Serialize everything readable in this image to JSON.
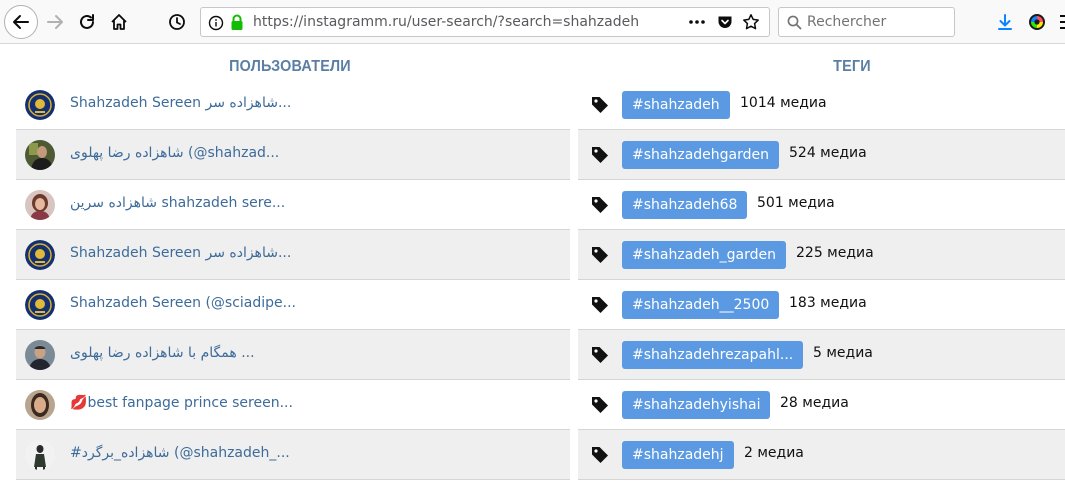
{
  "browser": {
    "url": "https://instagramm.ru/user-search/?search=shahzadeh",
    "search_placeholder": "Rechercher"
  },
  "headers": {
    "users": "ПОЛЬЗОВАТЕЛИ",
    "tags": "ТЕГИ"
  },
  "colors": {
    "header_blue": "#5b7ea4",
    "link_blue": "#3d6b9a",
    "tag_pill": "#5b9ae2",
    "row_alt": "#efefef"
  },
  "users": [
    {
      "name": "Shahzadeh Sereen شاهزاده سر...",
      "avatar": "emblem-avatar"
    },
    {
      "name": "شاهزاده رضا پهلوی (@shahzad...",
      "avatar": "photo-avatar"
    },
    {
      "name": "شاهزاده سرین shahzadeh sere...",
      "avatar": "photo-avatar"
    },
    {
      "name": "Shahzadeh Sereen شاهزاده سر...",
      "avatar": "emblem-avatar"
    },
    {
      "name": "Shahzadeh Sereen (@sciadipe...",
      "avatar": "emblem-avatar"
    },
    {
      "name": "همگام با شاهزاده رضا پهلوی ...",
      "avatar": "photo-avatar"
    },
    {
      "name": "best fanpage prince sereen...",
      "avatar": "photo-avatar",
      "prefix_icon": "💋"
    },
    {
      "name": "#شاهزاده_برگرد (@shahzadeh_...",
      "avatar": "photo-avatar"
    }
  ],
  "tags": [
    {
      "label": "#shahzadeh",
      "count": "1014 медиа"
    },
    {
      "label": "#shahzadehgarden",
      "count": "524 медиа"
    },
    {
      "label": "#shahzadeh68",
      "count": "501 медиа"
    },
    {
      "label": "#shahzadeh_garden",
      "count": "225 медиа"
    },
    {
      "label": "#shahzadeh__2500",
      "count": "183 медиа"
    },
    {
      "label": "#shahzadehrezapahl...",
      "count": "5 медиа"
    },
    {
      "label": "#shahzadehyishai",
      "count": "28 медиа"
    },
    {
      "label": "#shahzadehj",
      "count": "2 медиа"
    }
  ]
}
